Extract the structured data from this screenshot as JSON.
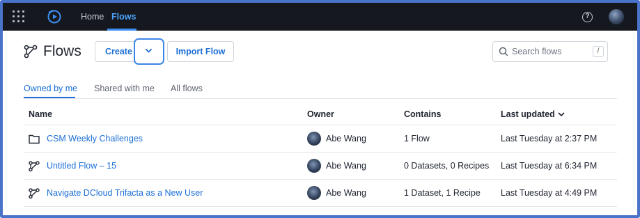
{
  "topbar": {
    "nav": [
      {
        "label": "Home"
      },
      {
        "label": "Flows"
      }
    ],
    "help_symbol": "?"
  },
  "header": {
    "title": "Flows",
    "create_label": "Create",
    "import_label": "Import Flow",
    "search_placeholder": "Search flows",
    "search_shortcut": "/"
  },
  "tabs": [
    {
      "label": "Owned by me",
      "active": true
    },
    {
      "label": "Shared with me",
      "active": false
    },
    {
      "label": "All flows",
      "active": false
    }
  ],
  "table": {
    "columns": [
      "Name",
      "Owner",
      "Contains",
      "Last updated"
    ],
    "rows": [
      {
        "icon": "folder-icon",
        "name": "CSM Weekly Challenges",
        "owner": "Abe Wang",
        "contains": "1 Flow",
        "updated": "Last Tuesday at 2:37 PM"
      },
      {
        "icon": "flow-icon",
        "name": "Untitled Flow – 15",
        "owner": "Abe Wang",
        "contains": "0 Datasets, 0 Recipes",
        "updated": "Last Tuesday at 6:34 PM"
      },
      {
        "icon": "flow-icon",
        "name": "Navigate DCloud Trifacta as a New User",
        "owner": "Abe Wang",
        "contains": "1 Dataset, 1 Recipe",
        "updated": "Last Tuesday at 4:49 PM"
      }
    ]
  },
  "colors": {
    "accent": "#1c6fd6",
    "topbar_bg": "#15181f",
    "frame_border": "#4a74c9"
  }
}
